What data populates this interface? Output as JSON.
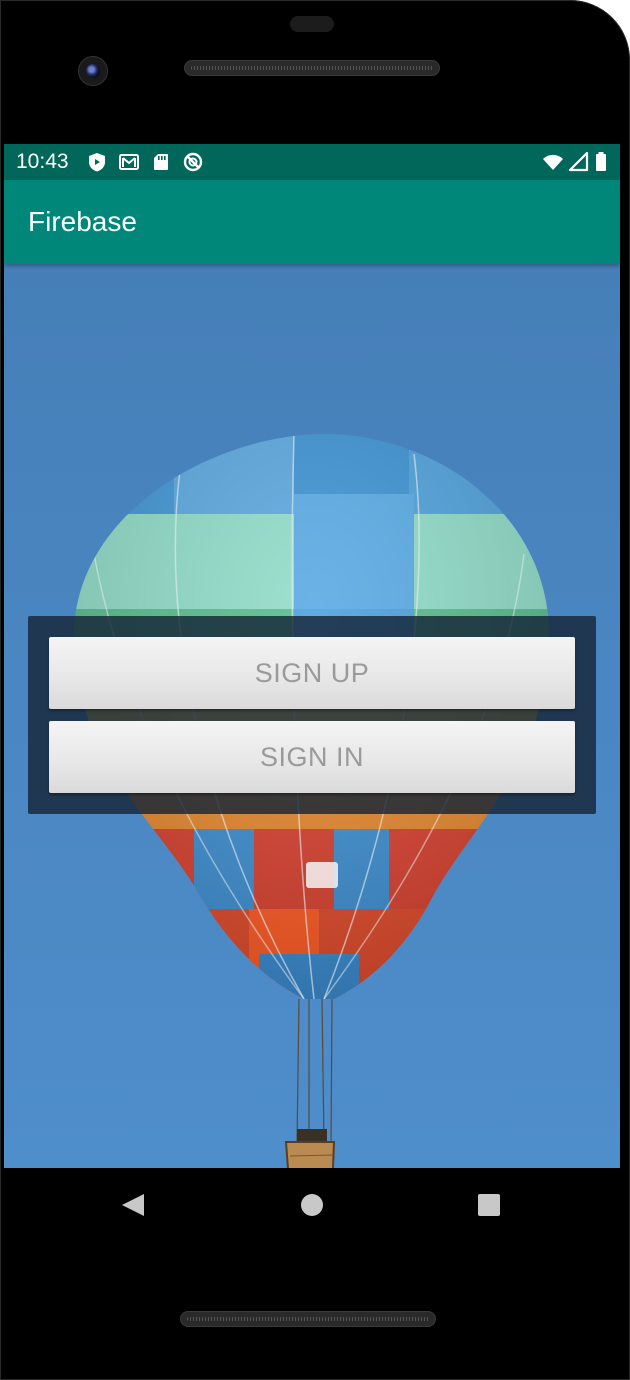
{
  "status_bar": {
    "time": "10:43",
    "left_icons": [
      "shield-icon",
      "gmail-icon",
      "sd-card-icon",
      "do-not-disturb-icon"
    ],
    "right_icons": [
      "wifi-icon",
      "cell-signal-icon",
      "battery-icon"
    ]
  },
  "app_bar": {
    "title": "Firebase"
  },
  "auth_panel": {
    "sign_up_label": "SIGN UP",
    "sign_in_label": "SIGN IN"
  },
  "nav_bar": {
    "back": "back-icon",
    "home": "home-icon",
    "recents": "recents-icon"
  },
  "colors": {
    "status_bar": "#00675a",
    "app_bar": "#00877a",
    "sky": "#4a86c1",
    "panel": "#162638",
    "button": "#e8e8e8",
    "button_text": "#9a9a9a"
  }
}
